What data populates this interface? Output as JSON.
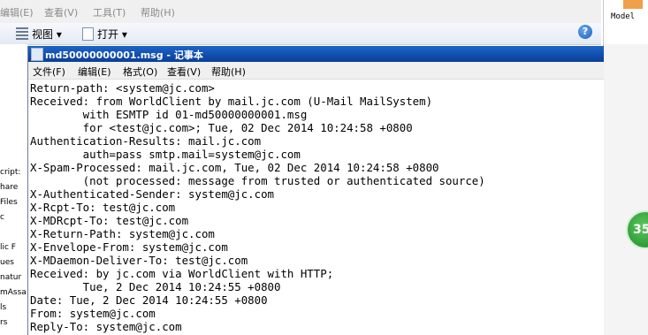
{
  "background_window": {
    "menu": [
      "编辑(E)",
      "查看(V)",
      "工具(T)",
      "帮助(H)"
    ],
    "toolbar": {
      "views_label": "视图 ▾",
      "open_label": "打开 ▾"
    },
    "help_icon_glyph": "?",
    "right_panel_label": "Model",
    "left_list": [
      "cript:",
      "hare",
      "Files",
      "c",
      "lic F",
      "ues",
      "natur",
      "mAssa",
      "ls",
      "rs"
    ],
    "badge_text": "35"
  },
  "notepad": {
    "title": "md50000000001.msg - 记事本",
    "menu": [
      "文件(F)",
      "编辑(E)",
      "格式(O)",
      "查看(V)",
      "帮助(H)"
    ],
    "lines": [
      "Return-path: <system@jc.com>",
      "Received: from WorldClient by mail.jc.com (U-Mail MailSystem)",
      "        with ESMTP id 01-md50000000001.msg",
      "        for <test@jc.com>; Tue, 02 Dec 2014 10:24:58 +0800",
      "Authentication-Results: mail.jc.com",
      "        auth=pass smtp.mail=system@jc.com",
      "X-Spam-Processed: mail.jc.com, Tue, 02 Dec 2014 10:24:58 +0800",
      "        (not processed: message from trusted or authenticated source)",
      "X-Authenticated-Sender: system@jc.com",
      "X-Rcpt-To: test@jc.com",
      "X-MDRcpt-To: test@jc.com",
      "X-Return-Path: system@jc.com",
      "X-Envelope-From: system@jc.com",
      "X-MDaemon-Deliver-To: test@jc.com",
      "Received: by jc.com via WorldClient with HTTP;",
      "        Tue, 2 Dec 2014 10:24:55 +0800",
      "Date: Tue, 2 Dec 2014 10:24:55 +0800",
      "From: system@jc.com",
      "Reply-To: system@jc.com"
    ]
  },
  "colors": {
    "title_bar": "#0a3f98",
    "badge": "#1d8a2b"
  }
}
